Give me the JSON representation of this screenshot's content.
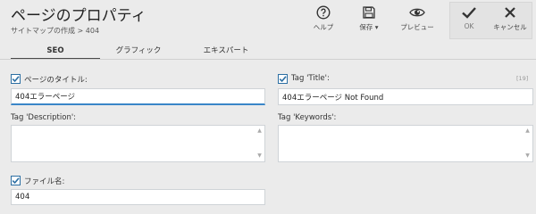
{
  "header": {
    "title": "ページのプロパティ",
    "breadcrumb": "サイトマップの作成 > 404"
  },
  "toolbar": {
    "help_label": "ヘルプ",
    "save_label": "保存 ▾",
    "preview_label": "プレビュー",
    "ok_label": "OK",
    "cancel_label": "キャンセル",
    "icons": [
      "help-icon",
      "floppy-disk-icon",
      "eye-icon",
      "checkmark-icon",
      "close-icon"
    ]
  },
  "tabs": [
    {
      "label": "SEO",
      "active": true
    },
    {
      "label": "グラフィック",
      "active": false
    },
    {
      "label": "エキスパート",
      "active": false
    }
  ],
  "form": {
    "page_title": {
      "label": "ページのタイトル:",
      "checked": true,
      "value": "404エラーページ"
    },
    "tag_title": {
      "label": "Tag 'Title':",
      "checked": true,
      "value": "404エラーページ  Not Found",
      "counter": "[19]"
    },
    "tag_description": {
      "label": "Tag 'Description':",
      "value": ""
    },
    "tag_keywords": {
      "label": "Tag 'Keywords':",
      "value": ""
    },
    "file_name": {
      "label": "ファイル名:",
      "checked": true,
      "value": "404"
    }
  },
  "colors": {
    "background": "#ebebeb",
    "accent": "#2c6fa3",
    "focus_underline": "#3a86c8"
  }
}
